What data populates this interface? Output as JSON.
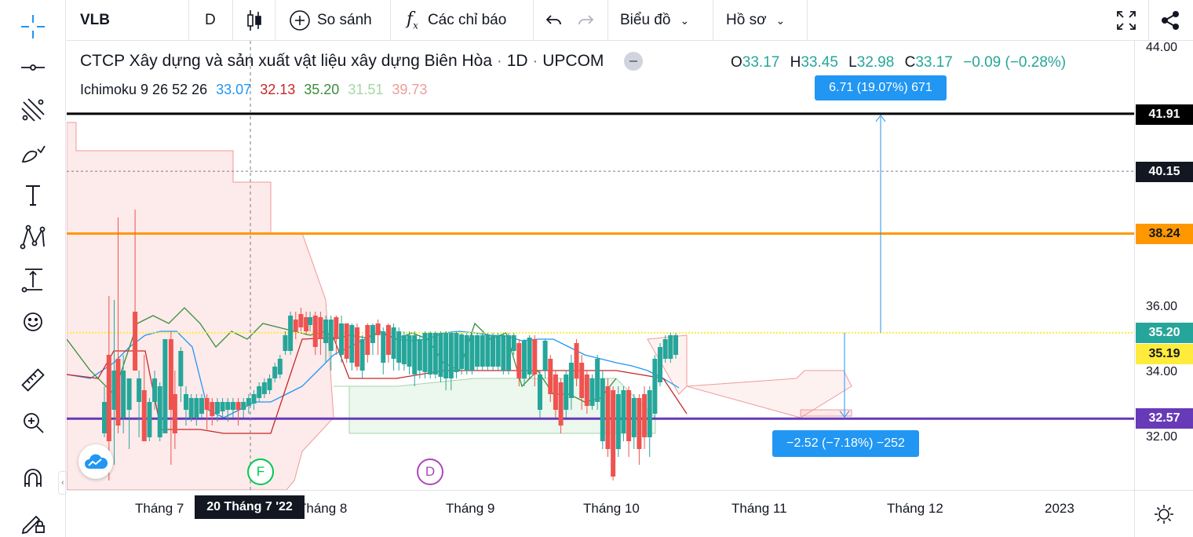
{
  "toolbar": {
    "symbol": "VLB",
    "interval": "D",
    "compare_label": "So sánh",
    "indicators_label": "Các chỉ báo",
    "chart_label": "Biểu đồ",
    "profile_label": "Hồ sơ"
  },
  "legend": {
    "title": "CTCP Xây dựng và sản xuất vật liệu xây dựng Biên Hòa",
    "interval": "1D",
    "exchange": "UPCOM",
    "sep": "·",
    "o_label": "O",
    "o": "33.17",
    "h_label": "H",
    "h": "33.45",
    "l_label": "L",
    "l": "32.98",
    "c_label": "C",
    "c": "33.17",
    "change": "−0.09 (−0.28%)"
  },
  "ichimoku": {
    "name": "Ichimoku",
    "params": "9 26 52 26",
    "v1": "33.07",
    "v2": "32.13",
    "v3": "35.20",
    "v4": "31.51",
    "v5": "39.73",
    "colors": [
      "#2196f3",
      "#c62828",
      "#388e3c",
      "#a5d6a7",
      "#ef9a9a"
    ]
  },
  "price_axis": {
    "ticks": [
      "44.00",
      "36.00",
      "34.00",
      "32.00"
    ],
    "tags": [
      {
        "value": "41.91",
        "bg": "#000000",
        "fg": "#ffffff"
      },
      {
        "value": "40.15",
        "bg": "#131722",
        "fg": "#ffffff"
      },
      {
        "value": "38.24",
        "bg": "#ff9800",
        "fg": "#131722"
      },
      {
        "value": "35.20",
        "bg": "#26a69a",
        "fg": "#ffffff"
      },
      {
        "value": "35.19",
        "bg": "#ffeb3b",
        "fg": "#131722"
      },
      {
        "value": "32.57",
        "bg": "#673ab7",
        "fg": "#ffffff"
      }
    ]
  },
  "time_axis": {
    "labels": [
      "Tháng 7",
      "Tháng 8",
      "Tháng 9",
      "Tháng 10",
      "Tháng 11",
      "Tháng 12",
      "2023"
    ],
    "crosshair_label": "20 Tháng 7 '22"
  },
  "measures": {
    "up": "6.71 (19.07%) 671",
    "down": "−2.52 (−7.18%) −252"
  },
  "markers": {
    "f": "F",
    "d": "D"
  },
  "colors": {
    "up": "#26a69a",
    "down": "#ef5350",
    "black_line": "#000000",
    "orange_line": "#ff9800",
    "purple_line": "#673ab7",
    "yellow_line": "#ffeb3b",
    "measure": "#2196f3"
  },
  "chart_data": {
    "type": "candlestick",
    "title": "CTCP Xây dựng và sản xuất vật liệu xây dựng Biên Hòa",
    "ylim": [
      30.4,
      44.1
    ],
    "horizontal_lines": [
      41.91,
      40.15,
      38.24,
      35.2,
      35.19,
      32.57
    ],
    "last": {
      "o": 33.17,
      "h": 33.45,
      "l": 32.98,
      "c": 33.17
    }
  }
}
